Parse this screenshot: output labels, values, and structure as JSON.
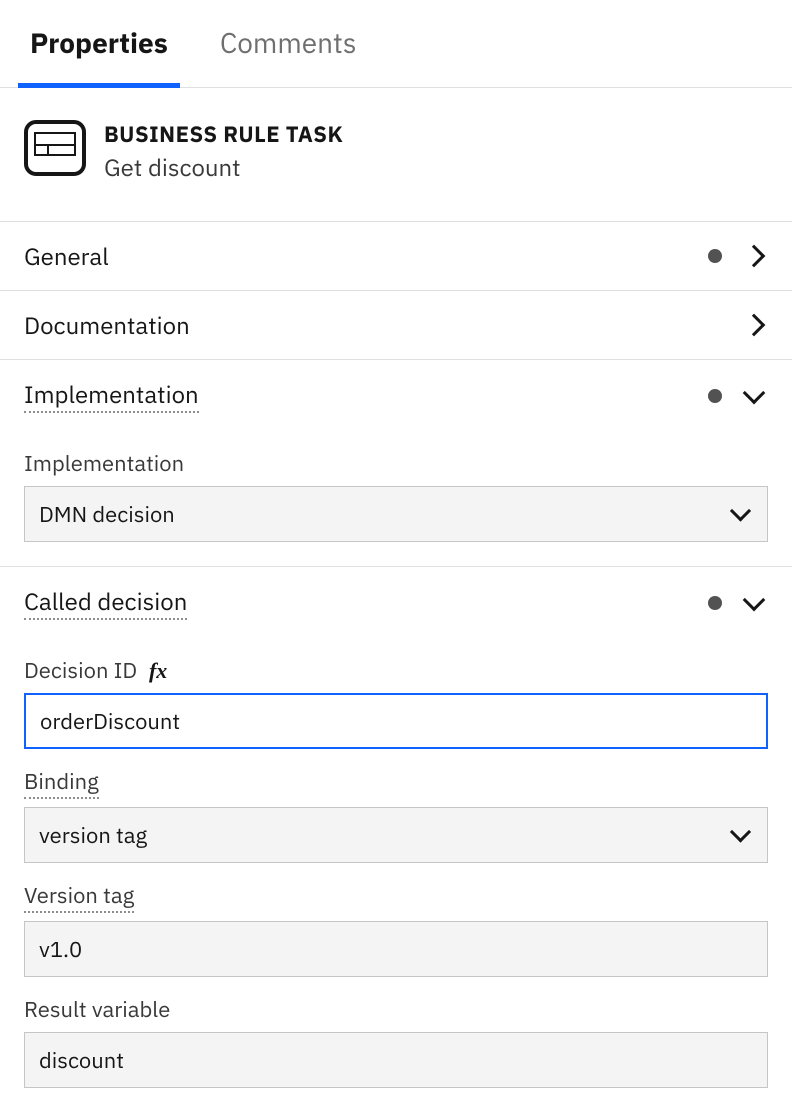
{
  "tabs": {
    "properties": "Properties",
    "comments": "Comments"
  },
  "header": {
    "type": "BUSINESS RULE TASK",
    "name": "Get discount"
  },
  "sections": {
    "general": {
      "title": "General"
    },
    "documentation": {
      "title": "Documentation"
    },
    "implementation": {
      "title": "Implementation",
      "field_label": "Implementation",
      "value": "DMN decision"
    },
    "called_decision": {
      "title": "Called decision",
      "decision_id_label": "Decision ID",
      "decision_id_value": "orderDiscount",
      "binding_label": "Binding",
      "binding_value": "version tag",
      "version_tag_label": "Version tag",
      "version_tag_value": "v1.0",
      "result_variable_label": "Result variable",
      "result_variable_value": "discount"
    }
  }
}
